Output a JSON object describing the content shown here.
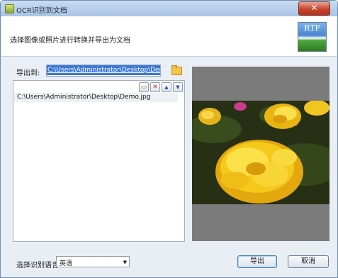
{
  "window": {
    "title": "OCR识别到文档",
    "close_glyph": "✕"
  },
  "header": {
    "instruction": "选择图像或照片进行转换并导出为文档",
    "logo_text": "RTF",
    "logo_icon": "rtf-document-icon"
  },
  "export": {
    "label": "导出到:",
    "path": "C:\\Users\\Administrator\\Desktop\\Demo.RTF",
    "browse_icon": "folder-icon"
  },
  "file_list": {
    "items": [
      "C:\\Users\\Administrator\\Desktop\\Demo.jpg"
    ],
    "toolbar": [
      {
        "name": "add-file-icon",
        "glyph": "▭"
      },
      {
        "name": "delete-icon",
        "glyph": "✕"
      },
      {
        "name": "move-up-icon",
        "glyph": "▲"
      },
      {
        "name": "move-down-icon",
        "glyph": "▼"
      }
    ]
  },
  "language": {
    "label": "选择识别语言:",
    "selected": "英语"
  },
  "buttons": {
    "export": "导出",
    "cancel": "取消"
  },
  "colors": {
    "accent": "#3b78d6",
    "preview_bg": "#7b7b7b"
  }
}
